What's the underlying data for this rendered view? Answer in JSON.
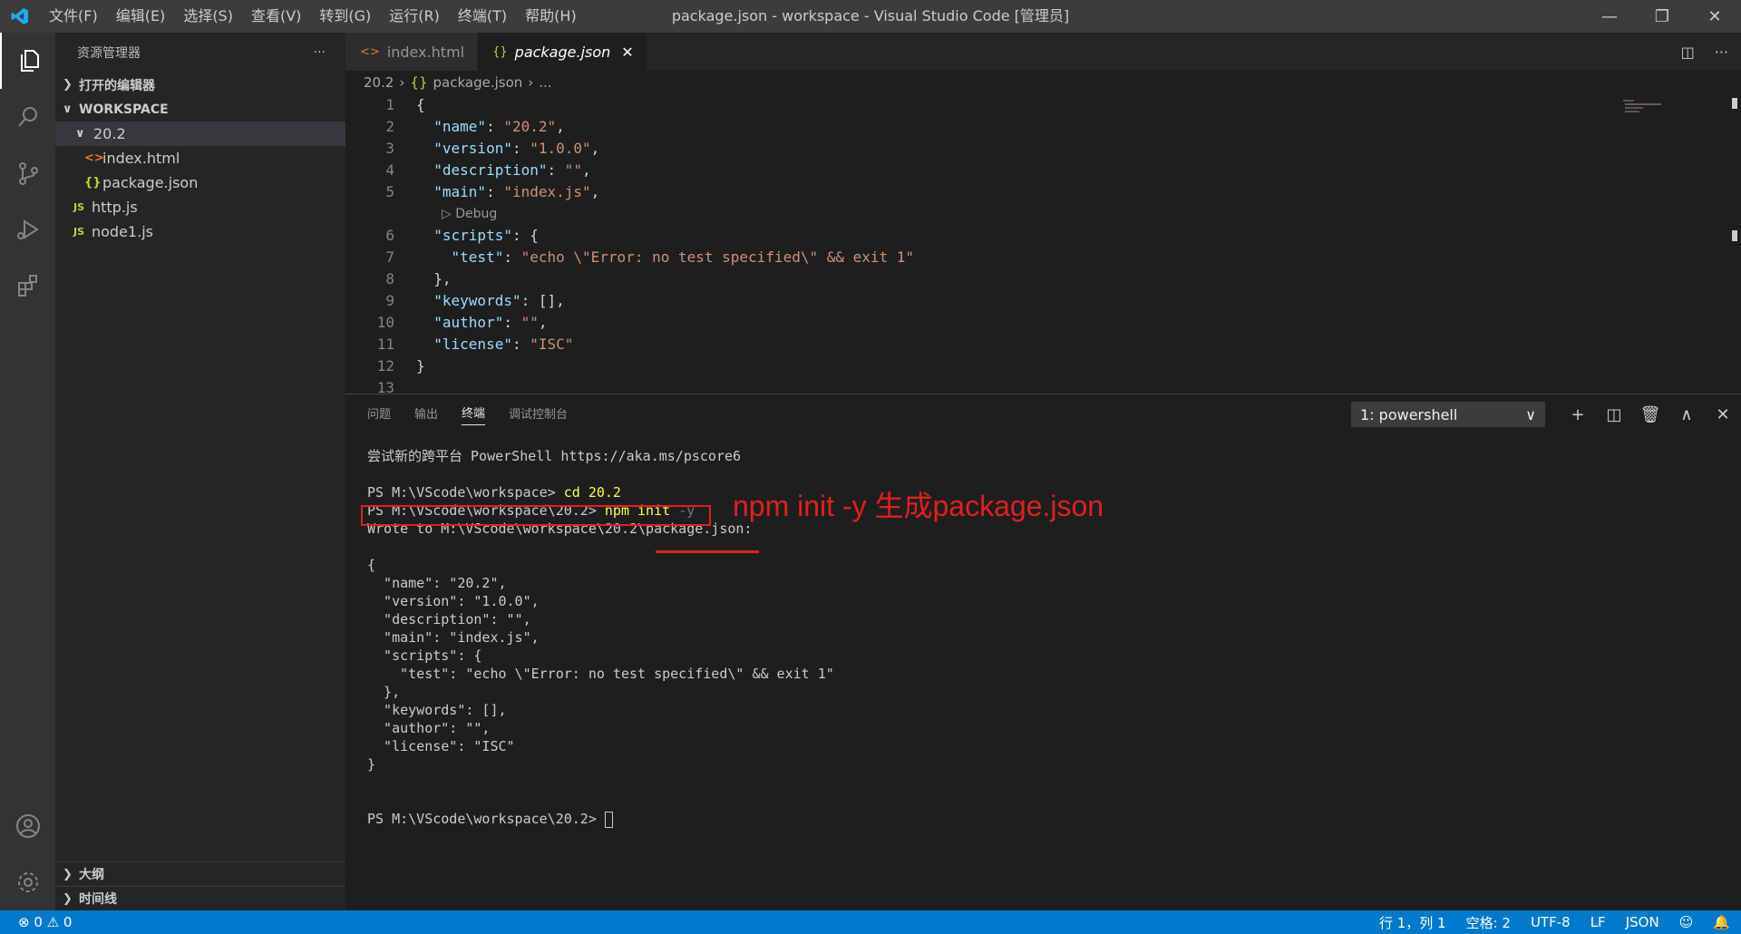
{
  "titlebar": {
    "menus": [
      "文件(F)",
      "编辑(E)",
      "选择(S)",
      "查看(V)",
      "转到(G)",
      "运行(R)",
      "终端(T)",
      "帮助(H)"
    ],
    "title": "package.json - workspace - Visual Studio Code [管理员]"
  },
  "sidebar": {
    "header": "资源管理器",
    "open_editors": "打开的编辑器",
    "workspace": "WORKSPACE",
    "folder": "20.2",
    "files": [
      {
        "name": "index.html",
        "icon": "html-file-icon"
      },
      {
        "name": "package.json",
        "icon": "json-file-icon"
      },
      {
        "name": "http.js",
        "icon": "js-file-icon"
      },
      {
        "name": "node1.js",
        "icon": "js-file-icon"
      }
    ],
    "outline": "大纲",
    "timeline": "时间线"
  },
  "tabs": [
    {
      "label": "index.html"
    },
    {
      "label": "package.json"
    }
  ],
  "breadcrumb": {
    "folder": "20.2",
    "file": "package.json",
    "more": "..."
  },
  "editor": {
    "codelens": "Debug",
    "line_numbers": [
      "1",
      "2",
      "3",
      "4",
      "5",
      "6",
      "7",
      "8",
      "9",
      "10",
      "11",
      "12",
      "13"
    ]
  },
  "panel": {
    "tabs": [
      "问题",
      "输出",
      "终端",
      "调试控制台"
    ],
    "active_tab": "终端",
    "terminal_select": "1: powershell",
    "terminal_lines": [
      "尝试新的跨平台 PowerShell https://aka.ms/pscore6",
      "",
      "PS M:\\VScode\\workspace> ",
      "PS M:\\VScode\\workspace\\20.2> ",
      "Wrote to M:\\VScode\\workspace\\20.2\\package.json:",
      "",
      "{",
      "  \"name\": \"20.2\",",
      "  \"version\": \"1.0.0\",",
      "  \"description\": \"\",",
      "  \"main\": \"index.js\",",
      "  \"scripts\": {",
      "    \"test\": \"echo \\\"Error: no test specified\\\" && exit 1\"",
      "  },",
      "  \"keywords\": [],",
      "  \"author\": \"\",",
      "  \"license\": \"ISC\"",
      "}",
      "",
      "",
      "PS M:\\VScode\\workspace\\20.2> "
    ],
    "cmd1": "cd 20.2",
    "cmd2": "npm init",
    "cmd2_flag": "-y",
    "annotation": "npm init -y 生成package.json",
    "annotation_color": "#e02020"
  },
  "statusbar": {
    "errors": "0",
    "warnings": "0",
    "position": "行 1，列 1",
    "spaces": "空格: 2",
    "encoding": "UTF-8",
    "eol": "LF",
    "language": "JSON"
  }
}
